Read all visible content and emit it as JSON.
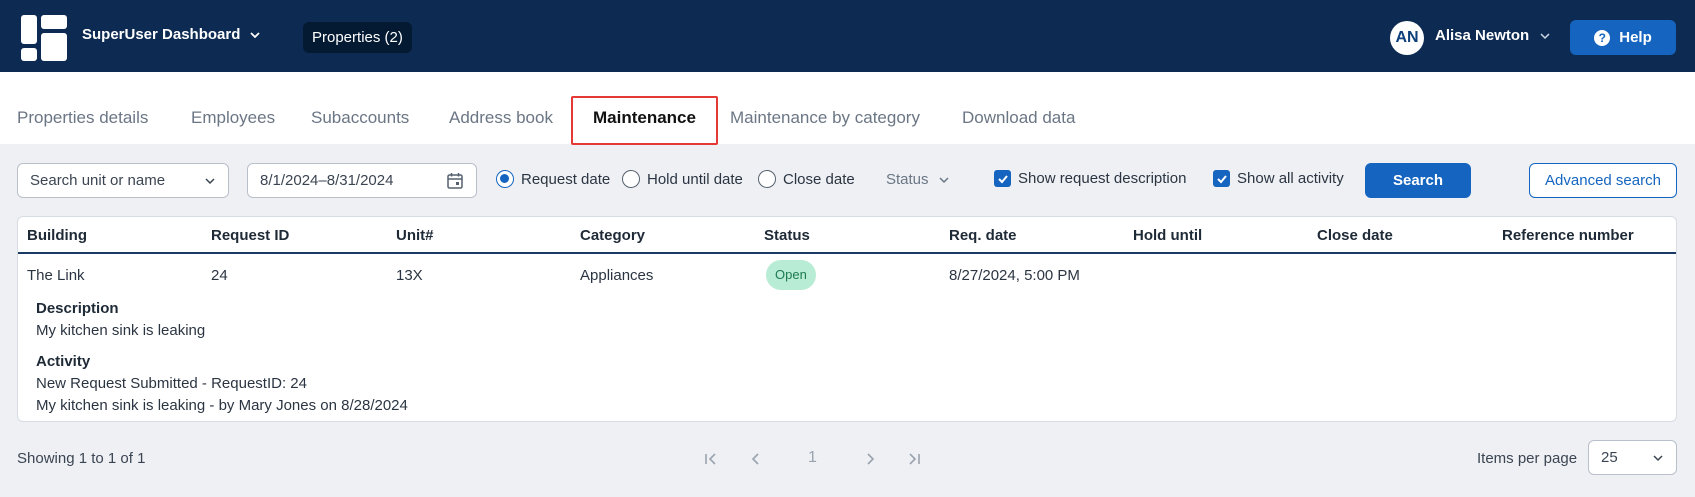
{
  "header": {
    "dashboard_label": "SuperUser Dashboard",
    "properties_label": "Properties (2)",
    "user_initials": "AN",
    "user_name": "Alisa Newton",
    "help_label": "Help",
    "help_icon": "question-circle-icon"
  },
  "tabs": [
    {
      "label": "Properties details",
      "active": false
    },
    {
      "label": "Employees",
      "active": false
    },
    {
      "label": "Subaccounts",
      "active": false
    },
    {
      "label": "Address book",
      "active": false
    },
    {
      "label": "Maintenance",
      "active": true
    },
    {
      "label": "Maintenance by category",
      "active": false
    },
    {
      "label": "Download data",
      "active": false
    }
  ],
  "filters": {
    "unit_select_value": "Search unit or name",
    "date_range_value": "8/1/2024–8/31/2024",
    "date_radios": [
      {
        "label": "Request date",
        "selected": true
      },
      {
        "label": "Hold until date",
        "selected": false
      },
      {
        "label": "Close date",
        "selected": false
      }
    ],
    "status_label": "Status",
    "show_description_label": "Show request description",
    "show_description_checked": true,
    "show_activity_label": "Show all activity",
    "show_activity_checked": true,
    "search_label": "Search",
    "advanced_search_label": "Advanced search"
  },
  "table": {
    "columns": [
      "Building",
      "Request ID",
      "Unit#",
      "Category",
      "Status",
      "Req. date",
      "Hold until",
      "Close date",
      "Reference number"
    ],
    "rows": [
      {
        "building": "The Link",
        "request_id": "24",
        "unit": "13X",
        "category": "Appliances",
        "status": "Open",
        "req_date": "8/27/2024, 5:00 PM",
        "hold_until": "",
        "close_date": "",
        "reference_number": "",
        "description_heading": "Description",
        "description": "My kitchen sink is leaking",
        "activity_heading": "Activity",
        "activity_lines": [
          "New Request Submitted - RequestID: 24",
          "My kitchen sink is leaking - by Mary Jones on 8/28/2024"
        ]
      }
    ]
  },
  "footer": {
    "showing_text": "Showing 1 to 1 of 1",
    "current_page": "1",
    "items_per_page_label": "Items per page",
    "items_per_page_value": "25"
  },
  "colors": {
    "topbar": "#0d2a52",
    "accent": "#1565c0",
    "open_badge_bg": "#b8ecd4",
    "open_badge_text": "#1d7a52",
    "tab_highlight": "#e53935"
  }
}
